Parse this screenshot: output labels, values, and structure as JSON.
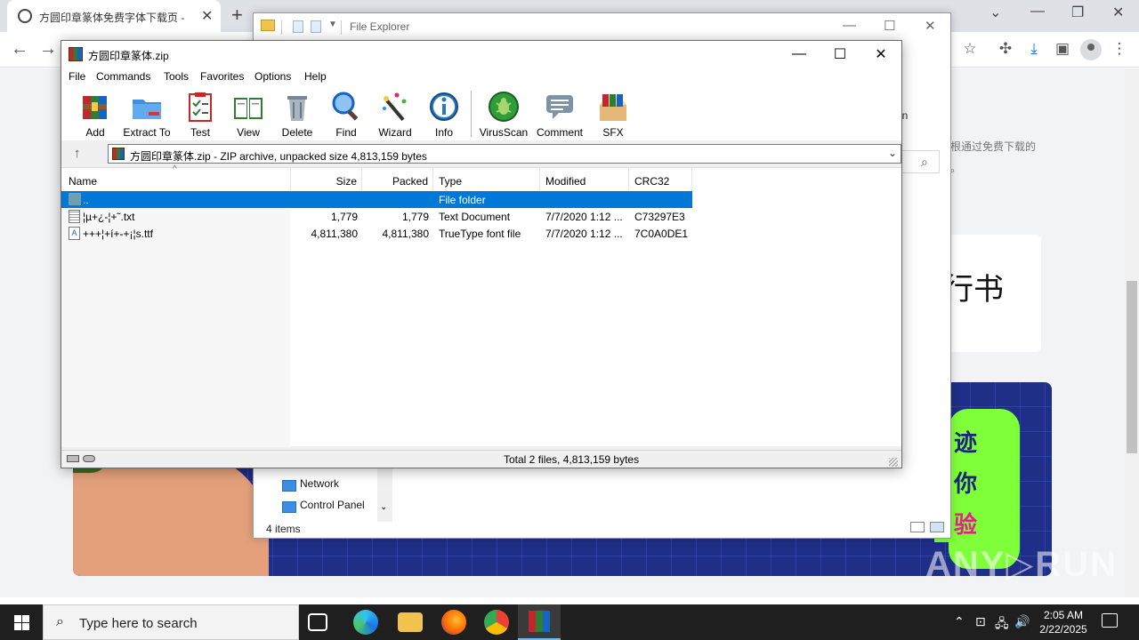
{
  "browser": {
    "tab_title": "方圆印章篆体免费字体下载页 - ",
    "help_icon_text": "?",
    "page_text_top": "根通过免费下载的",
    "page_text_dot": "。",
    "calligraphy": "行书",
    "banner_chars": [
      "迹",
      "你",
      "验"
    ]
  },
  "explorer": {
    "title": "File Explorer",
    "partial_tab": "tion",
    "nav_items": [
      "Network",
      "Control Panel"
    ],
    "status": "4 items"
  },
  "winrar": {
    "title": "方圆印章篆体.zip",
    "menu": [
      "File",
      "Commands",
      "Tools",
      "Favorites",
      "Options",
      "Help"
    ],
    "tools": [
      {
        "label": "Add",
        "icon": "add-icon"
      },
      {
        "label": "Extract To",
        "icon": "extract-to-icon"
      },
      {
        "label": "Test",
        "icon": "test-icon"
      },
      {
        "label": "View",
        "icon": "view-icon"
      },
      {
        "label": "Delete",
        "icon": "delete-icon"
      },
      {
        "label": "Find",
        "icon": "find-icon"
      },
      {
        "label": "Wizard",
        "icon": "wizard-icon"
      },
      {
        "label": "Info",
        "icon": "info-icon"
      },
      {
        "label": "VirusScan",
        "icon": "virusscan-icon"
      },
      {
        "label": "Comment",
        "icon": "comment-icon"
      },
      {
        "label": "SFX",
        "icon": "sfx-icon"
      }
    ],
    "address": "方圆印章篆体.zip - ZIP archive, unpacked size 4,813,159 bytes",
    "columns": {
      "name": "Name",
      "size": "Size",
      "packed": "Packed",
      "type": "Type",
      "modified": "Modified",
      "crc": "CRC32"
    },
    "rows": [
      {
        "name": "..",
        "size": "",
        "packed": "",
        "type": "File folder",
        "modified": "",
        "crc": ""
      },
      {
        "name": "¦µ+¿-¦+˜.txt",
        "size": "1,779",
        "packed": "1,779",
        "type": "Text Document",
        "modified": "7/7/2020 1:12 ...",
        "crc": "C73297E3"
      },
      {
        "name": "+++¦+í+-+¡¦s.ttf",
        "size": "4,811,380",
        "packed": "4,811,380",
        "type": "TrueType font file",
        "modified": "7/7/2020 1:12 ...",
        "crc": "7C0A0DE1"
      }
    ],
    "status": "Total 2 files, 4,813,159 bytes"
  },
  "taskbar": {
    "search_placeholder": "Type here to search",
    "time": "2:05 AM",
    "date": "2/22/2025"
  },
  "colors": {
    "selection": "#0078d7",
    "taskbar": "#1f1f1f",
    "banner": "#1f2e86",
    "bubble": "#7fff3a"
  }
}
